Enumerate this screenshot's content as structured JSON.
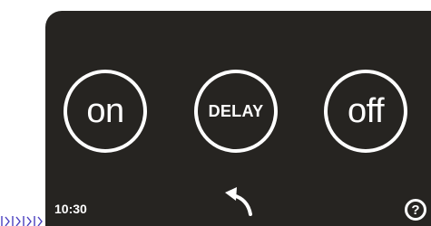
{
  "colors": {
    "screen_background": "#262421",
    "foreground": "#ffffff",
    "edge_marks": "#4a3fbf"
  },
  "buttons": {
    "on_label": "on",
    "delay_label": "DELAY",
    "off_label": "off"
  },
  "status": {
    "time": "10:30"
  },
  "footer": {
    "back_icon": "back-arrow-icon",
    "help_label": "?"
  }
}
